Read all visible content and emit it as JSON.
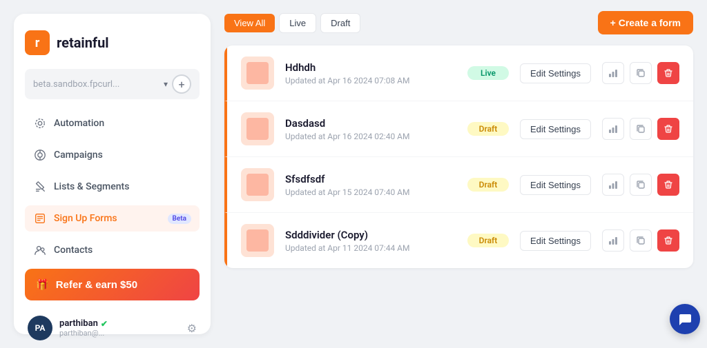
{
  "logo": {
    "icon_letter": "r",
    "name": "retainful"
  },
  "store_selector": {
    "placeholder": "beta.sandbox.fpcurl...",
    "chevron": "▾"
  },
  "nav": {
    "items": [
      {
        "id": "automation",
        "label": "Automation",
        "icon": "⚙"
      },
      {
        "id": "campaigns",
        "label": "Campaigns",
        "icon": "📢"
      },
      {
        "id": "lists-segments",
        "label": "Lists & Segments",
        "icon": "📋"
      },
      {
        "id": "signup-forms",
        "label": "Sign Up Forms",
        "icon": "📝",
        "badge": "Beta"
      },
      {
        "id": "contacts",
        "label": "Contacts",
        "icon": "👥"
      }
    ]
  },
  "refer_btn": {
    "label": "Refer & earn $50",
    "icon": "🎁"
  },
  "user": {
    "initials": "PA",
    "name": "parthiban",
    "verified": true,
    "email": "parthiban@..."
  },
  "toolbar": {
    "filters": [
      {
        "label": "View All",
        "active": true
      },
      {
        "label": "Live",
        "active": false
      },
      {
        "label": "Draft",
        "active": false
      }
    ],
    "create_btn": "+ Create a form"
  },
  "forms": [
    {
      "name": "Hdhdh",
      "date": "Updated at Apr 16 2024 07:08 AM",
      "status": "Live",
      "status_type": "live",
      "edit_label": "Edit Settings"
    },
    {
      "name": "Dasdasd",
      "date": "Updated at Apr 16 2024 02:40 AM",
      "status": "Draft",
      "status_type": "draft",
      "edit_label": "Edit Settings"
    },
    {
      "name": "Sfsdfsdf",
      "date": "Updated at Apr 15 2024 07:40 AM",
      "status": "Draft",
      "status_type": "draft",
      "edit_label": "Edit Settings"
    },
    {
      "name": "Sdddivider (Copy)",
      "date": "Updated at Apr 11 2024 07:44 AM",
      "status": "Draft",
      "status_type": "draft",
      "edit_label": "Edit Settings"
    }
  ]
}
